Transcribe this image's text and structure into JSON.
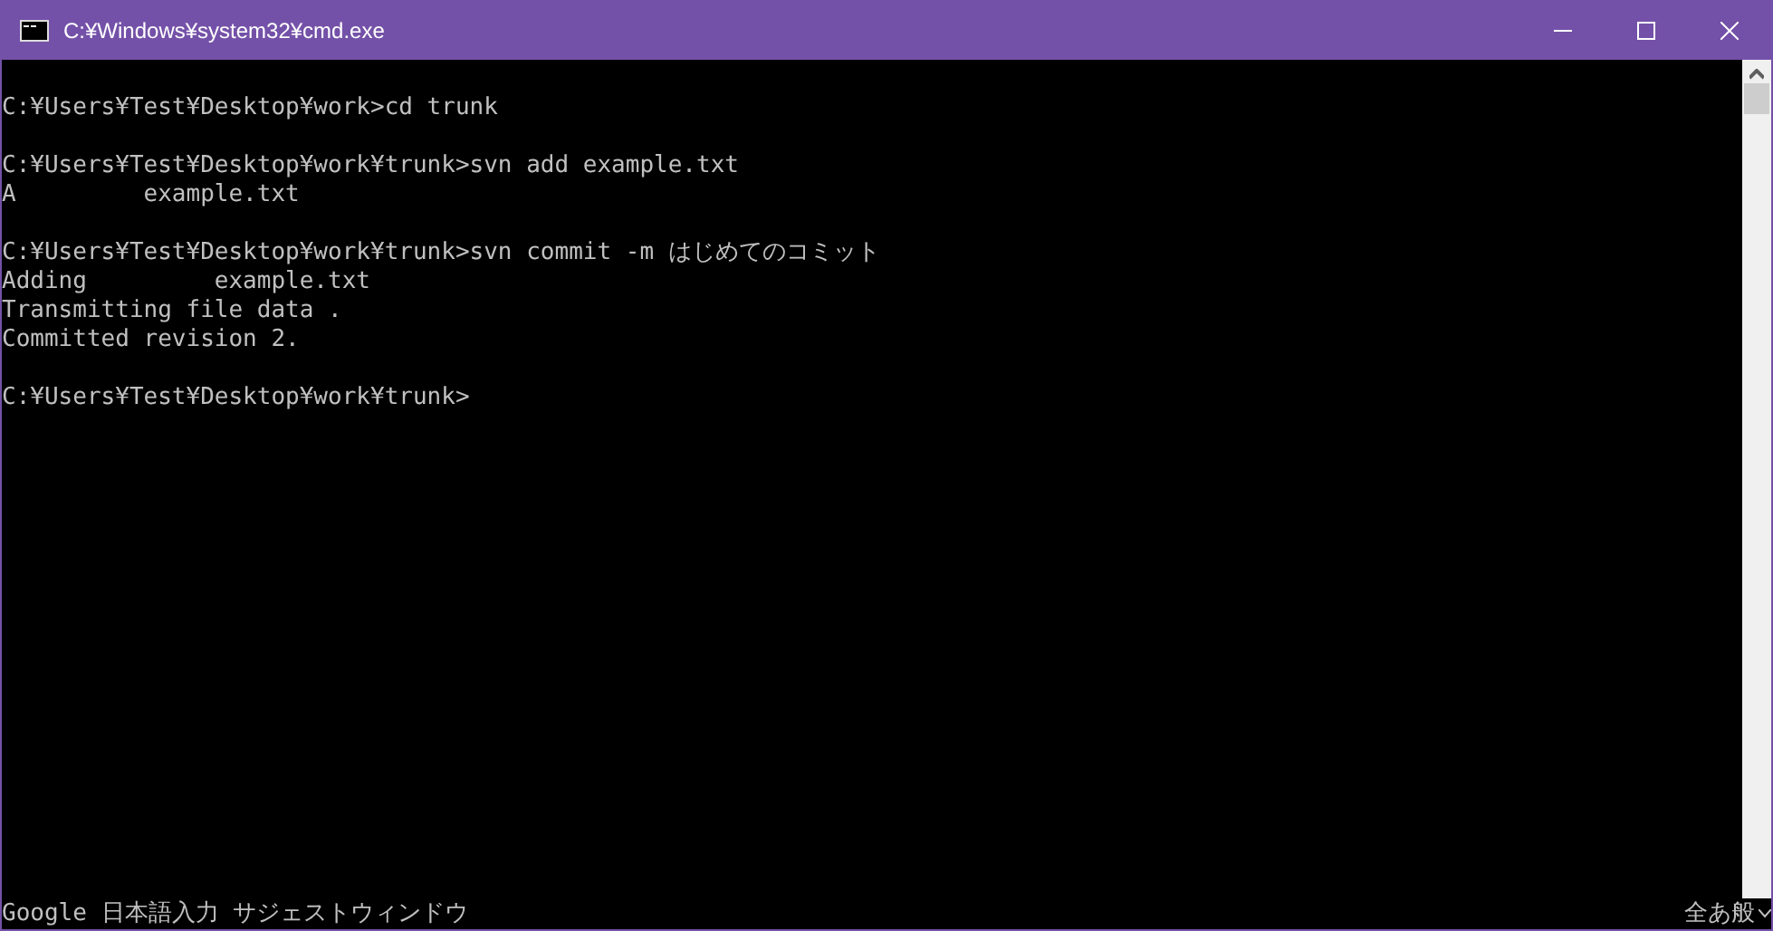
{
  "window": {
    "title": "C:¥Windows¥system32¥cmd.exe"
  },
  "console": {
    "blocks": [
      [
        "C:¥Users¥Test¥Desktop¥work>cd trunk"
      ],
      [
        "C:¥Users¥Test¥Desktop¥work¥trunk>svn add example.txt",
        "A         example.txt"
      ],
      [
        "C:¥Users¥Test¥Desktop¥work¥trunk>svn commit -m はじめてのコミット",
        "Adding         example.txt",
        "Transmitting file data .",
        "Committed revision 2."
      ],
      [
        "C:¥Users¥Test¥Desktop¥work¥trunk>"
      ]
    ]
  },
  "ime_bar": {
    "label": "Google 日本語入力 サジェストウィンドウ",
    "mode": "全あ般"
  }
}
